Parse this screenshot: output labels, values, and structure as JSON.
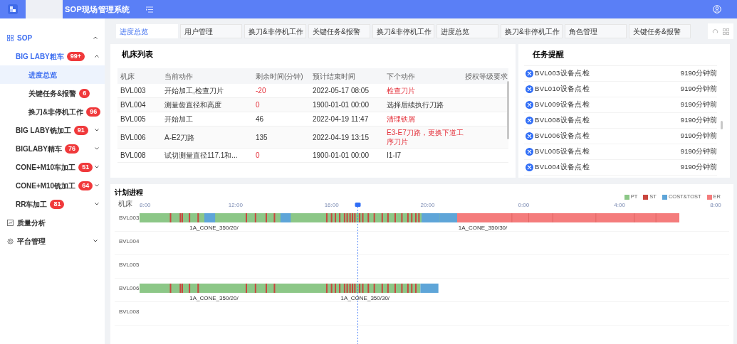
{
  "header": {
    "title": "SOP现场管理系统"
  },
  "sidebar": {
    "items": [
      {
        "kind": "group",
        "label": "SOP",
        "expanded": true,
        "children": [
          {
            "label": "BIG LABY粗车",
            "badge": "99+",
            "expanded": true,
            "children": [
              {
                "label": "进度总览",
                "selected": true
              },
              {
                "label": "关键任务&报警",
                "badge": "6",
                "selected": false
              },
              {
                "label": "换刀&非停机工作",
                "badge": "96",
                "selected": false
              }
            ]
          },
          {
            "label": "BIG LABY铣加工",
            "badge": "91",
            "expanded": false
          },
          {
            "label": "BIGLABY精车",
            "badge": "76",
            "expanded": false
          },
          {
            "label": "CONE+M10车加工",
            "badge": "51",
            "expanded": false
          },
          {
            "label": "CONE+M10铣加工",
            "badge": "64",
            "expanded": false
          },
          {
            "label": "RR车加工",
            "badge": "81",
            "expanded": false
          }
        ]
      },
      {
        "kind": "link",
        "label": "质量分析"
      },
      {
        "kind": "group",
        "label": "平台管理",
        "expanded": false
      }
    ]
  },
  "tabs": [
    {
      "label": "进度总览",
      "selected": true
    },
    {
      "label": "用户管理",
      "selected": false
    },
    {
      "label": "换刀&非停机工作",
      "selected": false
    },
    {
      "label": "关键任务&报警",
      "selected": false
    },
    {
      "label": "换刀&非停机工作",
      "selected": false
    },
    {
      "label": "进度总览",
      "selected": false
    },
    {
      "label": "换刀&非停机工作",
      "selected": false
    },
    {
      "label": "角色管理",
      "selected": false
    },
    {
      "label": "关键任务&报警",
      "selected": false
    }
  ],
  "machine_list": {
    "title": "机床列表",
    "columns": [
      "机床",
      "当前动作",
      "剩余时间(分钟)",
      "预计结束时间",
      "下个动作",
      "授权等级要求"
    ],
    "rows": [
      {
        "machine": "BVL003",
        "action": "开始加工,检查刀片",
        "remaining": "-20",
        "remaining_alert": true,
        "end_time": "2022-05-17 08:05",
        "next_action": "检查刀片",
        "next_alert": true
      },
      {
        "machine": "BVL004",
        "action": "测量齿直径和高度",
        "remaining": "0",
        "remaining_alert": true,
        "end_time": "1900-01-01 00:00",
        "next_action": "选择后续执行刀路",
        "next_alert": false
      },
      {
        "machine": "BVL005",
        "action": "开始加工",
        "remaining": "46",
        "remaining_alert": false,
        "end_time": "2022-04-19 11:47",
        "next_action": "清理铁屑",
        "next_alert": true
      },
      {
        "machine": "BVL006",
        "action": "A-E2刀路",
        "remaining": "135",
        "remaining_alert": false,
        "end_time": "2022-04-19 13:15",
        "next_action": "E3-E7刀路，更换下道工序刀片",
        "next_alert": true
      },
      {
        "machine": "BVL008",
        "action": "试切测量直径117.1和...",
        "remaining": "0",
        "remaining_alert": true,
        "end_time": "1900-01-01 00:00",
        "next_action": "I1-I7",
        "next_alert": false
      }
    ]
  },
  "tasks": {
    "title": "任务提醒",
    "items": [
      {
        "text": "BVL003设备点检",
        "time": "9190分钟前"
      },
      {
        "text": "BVL010设备点检",
        "time": "9190分钟前"
      },
      {
        "text": "BVL009设备点检",
        "time": "9190分钟前"
      },
      {
        "text": "BVL008设备点检",
        "time": "9190分钟前"
      },
      {
        "text": "BVL006设备点检",
        "time": "9190分钟前"
      },
      {
        "text": "BVL005设备点检",
        "time": "9190分钟前"
      },
      {
        "text": "BVL004设备点检",
        "time": "9190分钟前"
      }
    ]
  },
  "plan": {
    "title": "计划进程",
    "axis_label": "机床",
    "ticks": [
      "8:00",
      "12:00",
      "16:00",
      "20:00",
      "0:00",
      "4:00",
      "8:00"
    ],
    "legend": [
      {
        "label": "PT",
        "color": "#8cc787"
      },
      {
        "label": "ST",
        "color": "#c9463f"
      },
      {
        "label": "COST&TOST",
        "color": "#5ea5d8"
      },
      {
        "label": "ER",
        "color": "#f47c7c"
      }
    ],
    "rows": [
      {
        "machine": "BVL003",
        "jobs": [
          "1A_CONE_350/20/",
          "1A_CONE_350/30/"
        ]
      },
      {
        "machine": "BVL004",
        "jobs": []
      },
      {
        "machine": "BVL005",
        "jobs": []
      },
      {
        "machine": "BVL006",
        "jobs": [
          "1A_CONE_350/20/",
          "1A_CONE_350/30/"
        ]
      },
      {
        "machine": "BVL008",
        "jobs": []
      }
    ]
  }
}
